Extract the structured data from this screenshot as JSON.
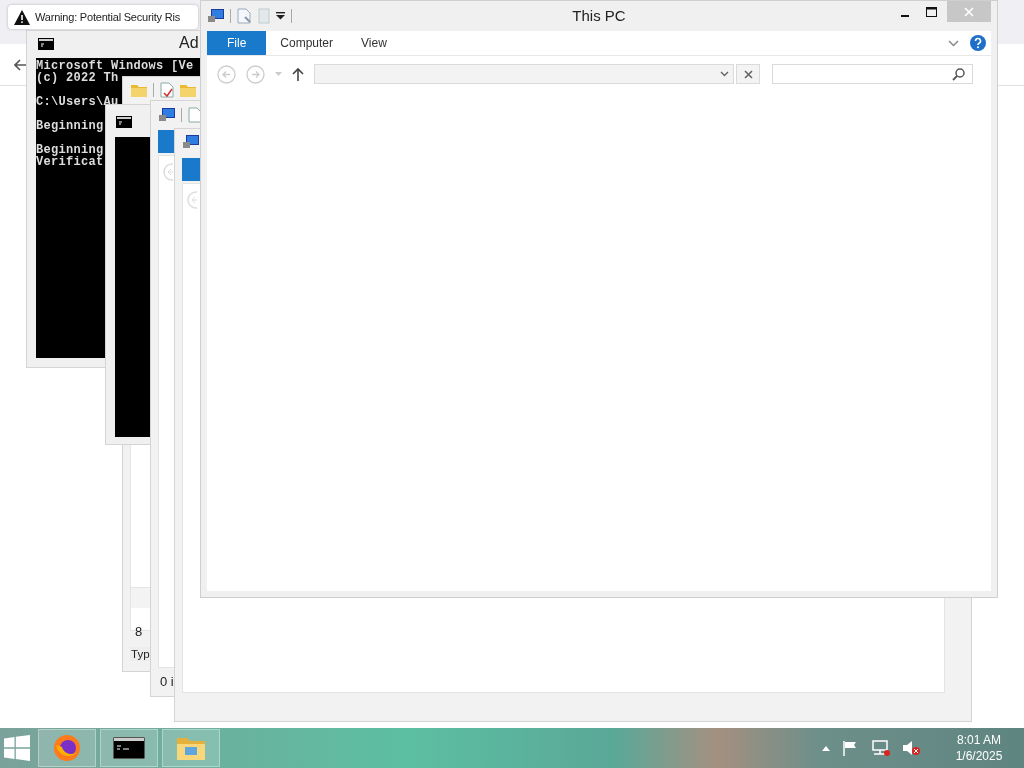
{
  "background_windows": [
    {
      "kind": "browser",
      "tab_title": "Warning: Potential Security Ris"
    },
    {
      "kind": "console",
      "title": "Ad",
      "blocks": [
        [
          "Microsoft Windows [Ve",
          "(c) 2022 Th"
        ],
        [
          "C:\\Users\\Au"
        ],
        [
          "Beginning"
        ],
        [
          "Beginning",
          "Verificat"
        ]
      ]
    },
    {
      "kind": "explorer",
      "item_value": "8",
      "detail_label": "Typ"
    },
    {
      "kind": "console"
    },
    {
      "kind": "explorer",
      "status_text": "0 i"
    },
    {
      "kind": "explorer"
    }
  ],
  "main_window": {
    "title": "This PC",
    "ribbon_tabs": [
      {
        "label": "File",
        "selected": true
      },
      {
        "label": "Computer",
        "selected": false
      },
      {
        "label": "View",
        "selected": false
      }
    ]
  },
  "taskbar": {
    "apps": [
      {
        "kind": "firefox"
      },
      {
        "kind": "console"
      },
      {
        "kind": "explorer"
      }
    ],
    "time": "8:01 AM",
    "date": "1/6/2025"
  }
}
